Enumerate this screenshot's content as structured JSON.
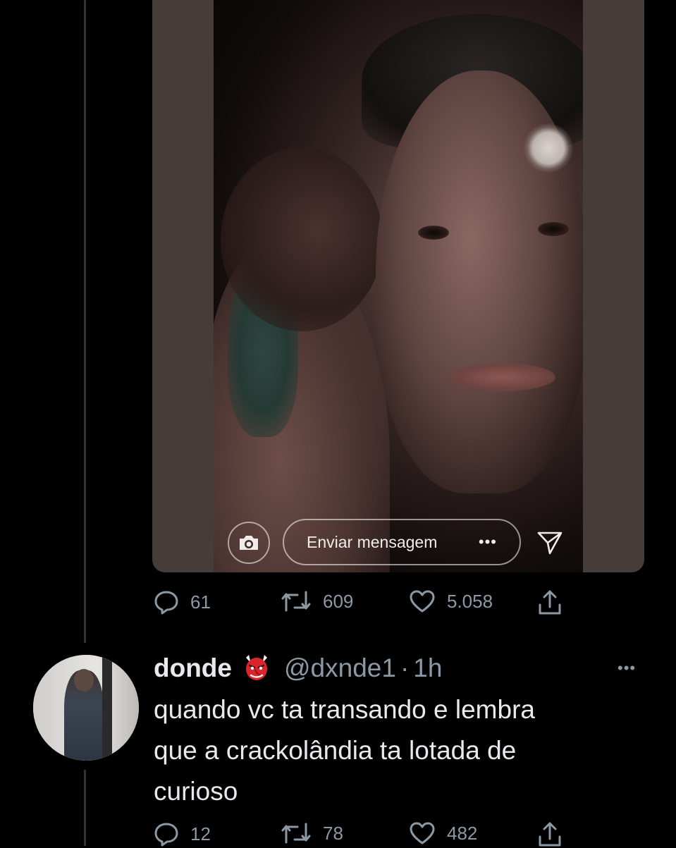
{
  "story": {
    "message_placeholder": "Enviar mensagem",
    "more_glyph": "•••"
  },
  "tweet_main": {
    "replies": "61",
    "retweets": "609",
    "likes": "5.058"
  },
  "reply": {
    "display_name": "donde",
    "emoji": "goblin-mask-emoji",
    "handle": "@dxnde1",
    "separator": "·",
    "time": "1h",
    "more_glyph": "•••",
    "text_lines": [
      "quando vc ta transando e lembra",
      "que a crackolândia ta lotada de",
      "curioso"
    ],
    "replies": "12",
    "retweets": "78",
    "likes": "482"
  },
  "colors": {
    "background": "#000000",
    "text_primary": "#e7e9ea",
    "text_secondary": "#8b98a5",
    "thread_line": "#333639",
    "media_border": "#463c3a"
  }
}
